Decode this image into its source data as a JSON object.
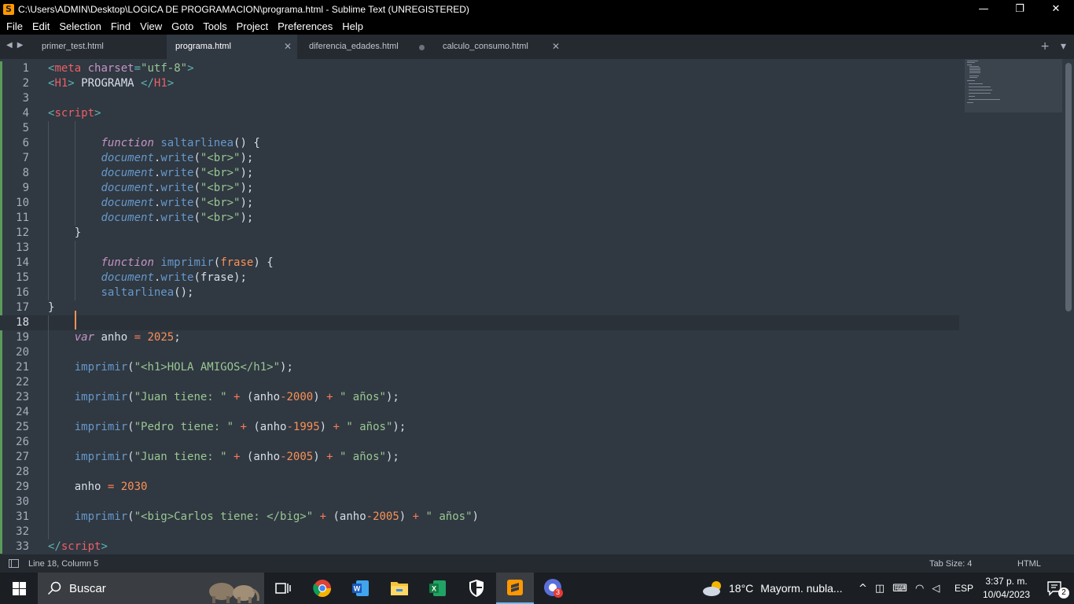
{
  "window": {
    "title": "C:\\Users\\ADMIN\\Desktop\\LOGICA DE PROGRAMACION\\programa.html - Sublime Text (UNREGISTERED)",
    "minimize": "—",
    "maximize": "❐",
    "close": "✕"
  },
  "menu": [
    "File",
    "Edit",
    "Selection",
    "Find",
    "View",
    "Goto",
    "Tools",
    "Project",
    "Preferences",
    "Help"
  ],
  "tabs": [
    {
      "label": "primer_test.html"
    },
    {
      "label": "programa.html",
      "active": true,
      "close": "✕"
    },
    {
      "label": "diferencia_edades.html",
      "dirty": true
    },
    {
      "label": "calculo_consumo.html",
      "close": "✕"
    }
  ],
  "tab_actions": {
    "add": "+",
    "more": "▾"
  },
  "editor": {
    "current_line": 18,
    "line_numbers": [
      "1",
      "2",
      "3",
      "4",
      "5",
      "6",
      "7",
      "8",
      "9",
      "10",
      "11",
      "12",
      "13",
      "14",
      "15",
      "16",
      "17",
      "18",
      "19",
      "20",
      "21",
      "22",
      "23",
      "24",
      "25",
      "26",
      "27",
      "28",
      "29",
      "30",
      "31",
      "32",
      "33"
    ]
  },
  "status": {
    "position": "Line 18, Column 5",
    "tab_size": "Tab Size: 4",
    "syntax": "HTML"
  },
  "taskbar": {
    "search_placeholder": "Buscar",
    "weather_temp": "18°C",
    "weather_desc": "Mayorm. nubla...",
    "language": "ESP",
    "time": "3:37 p. m.",
    "date": "10/04/2023",
    "notifications": "2",
    "chrome_badge": "3"
  },
  "colors": {
    "editor_bg": "#303841",
    "tag": "#ec5f67",
    "string": "#99c794",
    "keyword": "#c594c5",
    "function": "#6699cc",
    "number": "#f99157",
    "cursor": "#f99157"
  }
}
